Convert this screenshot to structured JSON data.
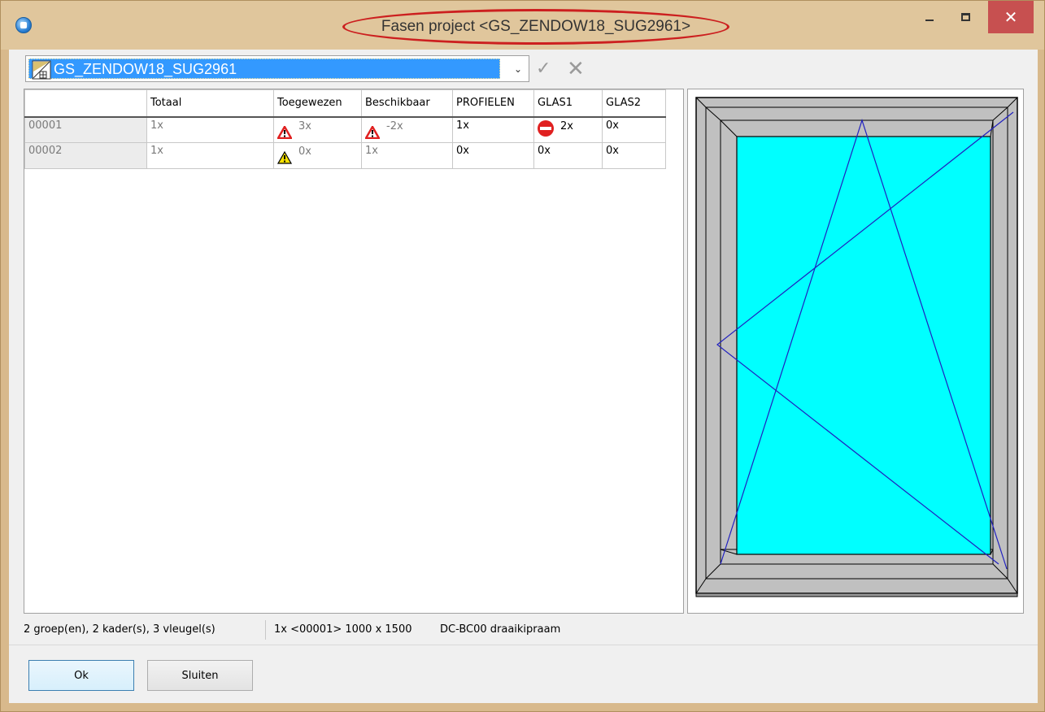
{
  "window": {
    "title": "Fasen project <GS_ZENDOW18_SUG2961>",
    "minimize_icon": "minimize-icon",
    "maximize_icon": "maximize-icon",
    "close_icon": "close-icon",
    "close_glyph": "✕"
  },
  "selector": {
    "value": "GS_ZENDOW18_SUG2961",
    "dropdown_glyph": "⌄",
    "confirm_glyph": "✓",
    "cancel_glyph": "✕"
  },
  "grid": {
    "columns": [
      "",
      "Totaal",
      "Toegewezen",
      "Beschikbaar",
      "PROFIELEN",
      "GLAS1",
      "GLAS2"
    ],
    "rows": [
      {
        "id": "00001",
        "totaal": "1x",
        "toegewezen": {
          "icon": "error-triangle-icon",
          "value": "3x"
        },
        "beschikbaar": {
          "icon": "error-triangle-icon",
          "value": "-2x"
        },
        "profielen": "1x",
        "glas1": {
          "icon": "no-entry-icon",
          "value": "2x"
        },
        "glas2": "0x"
      },
      {
        "id": "00002",
        "totaal": "1x",
        "toegewezen": {
          "icon": "warning-triangle-icon",
          "value": "0x"
        },
        "beschikbaar": "1x",
        "profielen": "0x",
        "glas1": "0x",
        "glas2": "0x"
      }
    ]
  },
  "status": {
    "summary": "2 groep(en), 2 kader(s), 3 vleugel(s)",
    "selection": "1x <00001> 1000 x 1500",
    "type": "DC-BC00 draaikipraam"
  },
  "buttons": {
    "ok": "Ok",
    "close": "Sluiten"
  },
  "colors": {
    "glass": "#00ffff",
    "frame": "#c0c0c0",
    "opening_lines": "#2020c0",
    "error": "#e02020",
    "warning": "#f5e000",
    "selection": "#3399ff"
  }
}
